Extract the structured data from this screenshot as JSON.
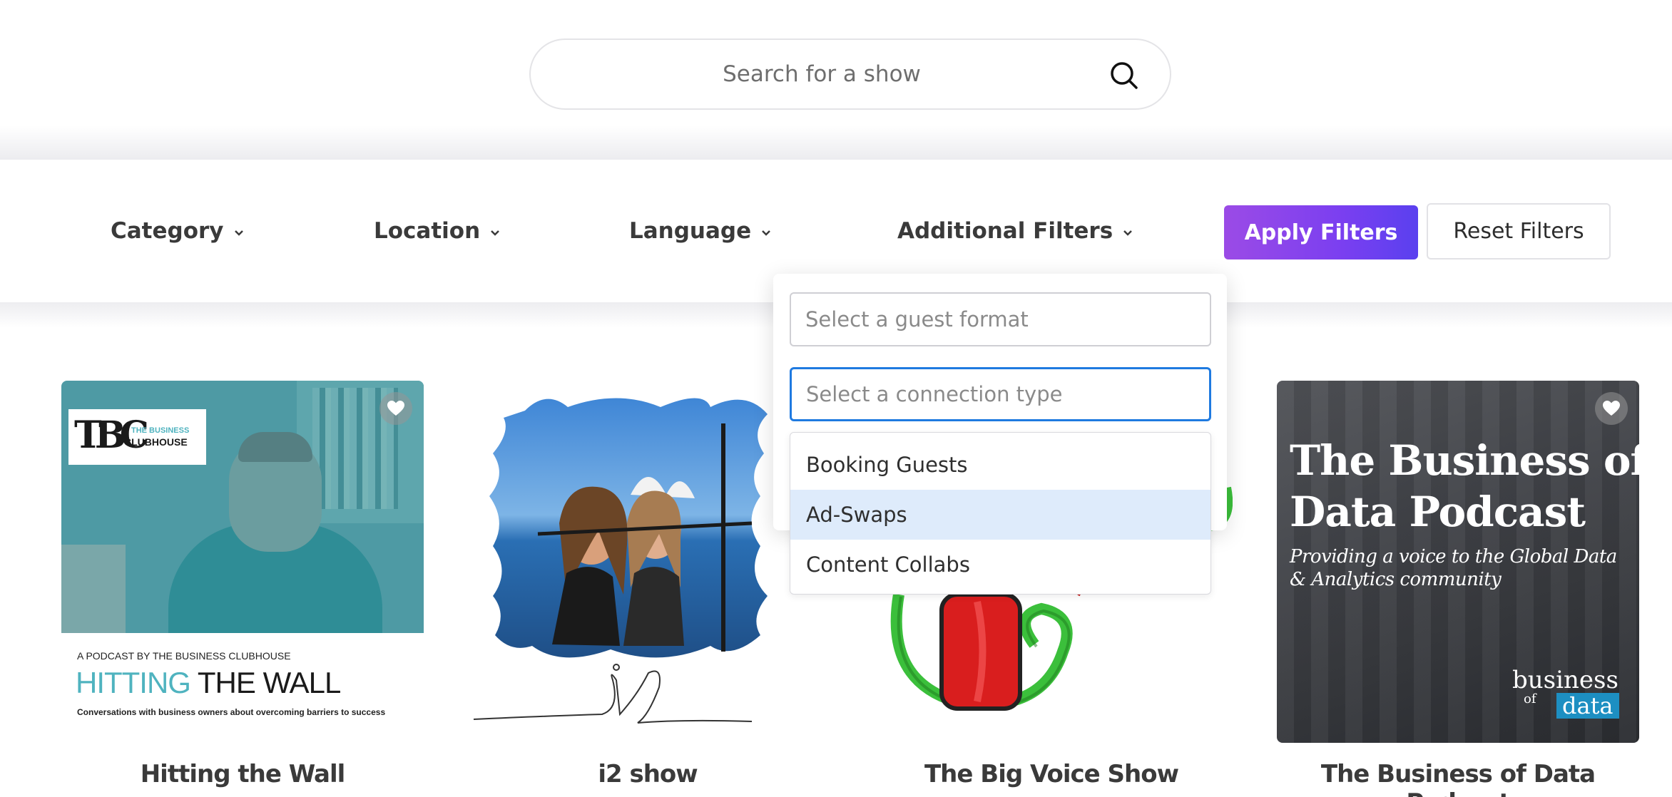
{
  "search": {
    "placeholder": "Search for a show"
  },
  "filters": {
    "tabs": [
      {
        "label": "Category"
      },
      {
        "label": "Location"
      },
      {
        "label": "Language"
      },
      {
        "label": "Additional Filters"
      }
    ],
    "apply_label": "Apply Filters",
    "reset_label": "Reset Filters"
  },
  "additional_filters": {
    "guest_format_placeholder": "Select a guest format",
    "connection_type_placeholder": "Select a connection type",
    "connection_options": [
      "Booking Guests",
      "Ad-Swaps",
      "Content Collabs"
    ],
    "highlighted_option": "Ad-Swaps"
  },
  "shows": [
    {
      "title": "Hitting the Wall",
      "art": {
        "logo_initials": "TBC",
        "logo_line1": "THE BUSINESS",
        "logo_line2": "CLUBHOUSE",
        "byline": "A PODCAST BY THE BUSINESS CLUBHOUSE",
        "headline_accent": "HITTING",
        "headline_rest": "THE WALL",
        "tagline": "Conversations with business owners about overcoming barriers to success"
      }
    },
    {
      "title": "i2 show",
      "art": {
        "signature": "i2"
      }
    },
    {
      "title": "The Big Voice Show",
      "art": {}
    },
    {
      "title": "The Business of Data Podcast",
      "art": {
        "headline_line1": "The Business of",
        "headline_line2": "Data Podcast",
        "subtitle_line1": "Providing a voice to the Global Data",
        "subtitle_line2": "& Analytics community",
        "logo_word1": "business",
        "logo_word2": "of",
        "logo_word3": "data"
      }
    }
  ],
  "colors": {
    "accent_start": "#9b4be6",
    "accent_end": "#5a40ef",
    "focus_blue": "#1f7ae0",
    "highlight_option": "#deebfb",
    "teal": "#4fb3bf"
  }
}
